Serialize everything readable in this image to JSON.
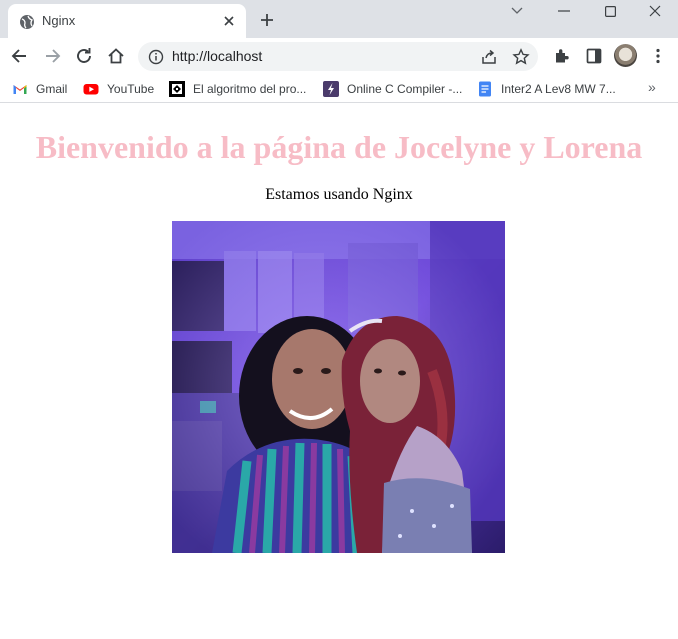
{
  "colors": {
    "heading": "#f7bcc6",
    "tabstrip": "#dee1e6",
    "accent_purple": "#6b3fd0"
  },
  "tab": {
    "title": "Nginx",
    "favicon": "globe-icon"
  },
  "toolbar": {
    "url": "http://localhost"
  },
  "bookmarks": [
    {
      "label": "Gmail",
      "icon": "gmail-icon"
    },
    {
      "label": "YouTube",
      "icon": "youtube-icon"
    },
    {
      "label": "El algoritmo del pro...",
      "icon": "algoritmo-icon"
    },
    {
      "label": "Online C Compiler -...",
      "icon": "compiler-icon"
    },
    {
      "label": "Inter2 A Lev8 MW 7...",
      "icon": "docs-icon"
    }
  ],
  "page": {
    "heading": "Bienvenido a la página de Jocelyne y Lorena",
    "subtext": "Estamos usando Nginx",
    "photo_icon": "photo-image"
  }
}
